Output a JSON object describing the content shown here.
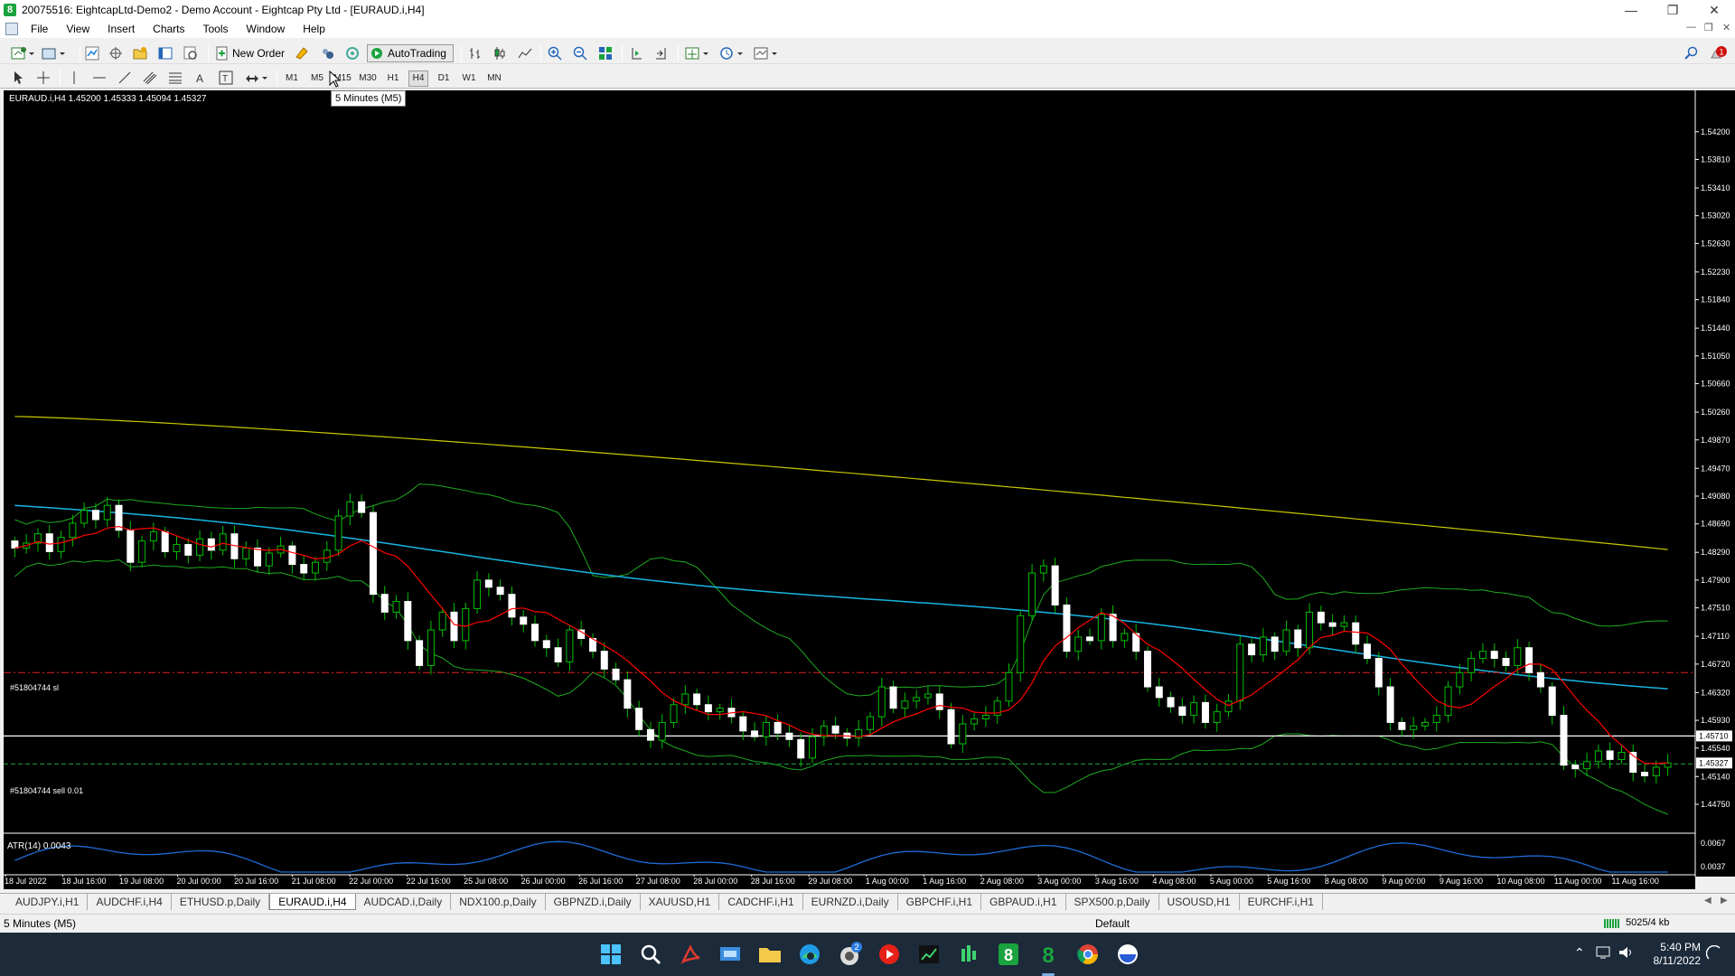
{
  "window": {
    "title": "20075516: EightcapLtd-Demo2 - Demo Account - Eightcap Pty Ltd - [EURAUD.i,H4]"
  },
  "menu": [
    "File",
    "View",
    "Insert",
    "Charts",
    "Tools",
    "Window",
    "Help"
  ],
  "toolbar": {
    "new_order": "New Order",
    "autotrading": "AutoTrading"
  },
  "timeframes": [
    "M1",
    "M5",
    "M15",
    "M30",
    "H1",
    "H4",
    "D1",
    "W1",
    "MN"
  ],
  "active_timeframe": "H4",
  "tooltip": "5 Minutes (M5)",
  "chart": {
    "info": "EURAUD.i,H4  1.45200 1.45333 1.45094 1.45327",
    "sl_label": "#51804744 sl",
    "order_label": "#51804744 sell 0.01",
    "atr_label": "ATR(14) 0.0043",
    "current_price_label": "1.45327",
    "hline_price_label": "1.45710",
    "atr_axis": [
      "0.0067",
      "0.0037"
    ]
  },
  "chart_data": {
    "type": "candlestick",
    "symbol": "EURAUD.i",
    "timeframe": "H4",
    "ylim": [
      1.4475,
      1.544
    ],
    "price_axis": [
      "1.54200",
      "1.53810",
      "1.53410",
      "1.53020",
      "1.52630",
      "1.52230",
      "1.51840",
      "1.51440",
      "1.51050",
      "1.50660",
      "1.50260",
      "1.49870",
      "1.49470",
      "1.49080",
      "1.48690",
      "1.48290",
      "1.47900",
      "1.47510",
      "1.47110",
      "1.46720",
      "1.46320",
      "1.45930",
      "1.45540",
      "1.45140",
      "1.44750"
    ],
    "time_axis": [
      "18 Jul 2022",
      "18 Jul 16:00",
      "19 Jul 08:00",
      "20 Jul 00:00",
      "20 Jul 16:00",
      "21 Jul 08:00",
      "22 Jul 00:00",
      "22 Jul 16:00",
      "25 Jul 08:00",
      "26 Jul 00:00",
      "26 Jul 16:00",
      "27 Jul 08:00",
      "28 Jul 00:00",
      "28 Jul 16:00",
      "29 Jul 08:00",
      "1 Aug 00:00",
      "1 Aug 16:00",
      "2 Aug 08:00",
      "3 Aug 00:00",
      "3 Aug 16:00",
      "4 Aug 08:00",
      "5 Aug 00:00",
      "5 Aug 16:00",
      "8 Aug 08:00",
      "9 Aug 00:00",
      "9 Aug 16:00",
      "10 Aug 08:00",
      "11 Aug 00:00",
      "11 Aug 16:00"
    ],
    "closes": [
      1.4835,
      1.4842,
      1.4855,
      1.483,
      1.485,
      1.487,
      1.4888,
      1.4875,
      1.4895,
      1.486,
      1.4815,
      1.4845,
      1.4858,
      1.483,
      1.484,
      1.4825,
      1.4848,
      1.4832,
      1.4855,
      1.482,
      1.4835,
      1.481,
      1.4828,
      1.4838,
      1.4812,
      1.48,
      1.4815,
      1.4832,
      1.488,
      1.49,
      1.4885,
      1.477,
      1.4745,
      1.476,
      1.4705,
      1.467,
      1.472,
      1.4745,
      1.4705,
      1.475,
      1.479,
      1.478,
      1.477,
      1.4738,
      1.4728,
      1.4705,
      1.4695,
      1.4675,
      1.472,
      1.4708,
      1.469,
      1.4665,
      1.465,
      1.461,
      1.458,
      1.4565,
      1.459,
      1.4615,
      1.463,
      1.4615,
      1.4605,
      1.461,
      1.4598,
      1.4578,
      1.457,
      1.459,
      1.4575,
      1.4566,
      1.454,
      1.457,
      1.4585,
      1.4575,
      1.4568,
      1.458,
      1.4598,
      1.464,
      1.461,
      1.462,
      1.4625,
      1.463,
      1.4608,
      1.456,
      1.4588,
      1.4595,
      1.46,
      1.462,
      1.466,
      1.474,
      1.48,
      1.481,
      1.4755,
      1.469,
      1.471,
      1.4705,
      1.4742,
      1.4705,
      1.4715,
      1.469,
      1.464,
      1.4625,
      1.4612,
      1.46,
      1.4618,
      1.459,
      1.4605,
      1.462,
      1.47,
      1.4685,
      1.471,
      1.469,
      1.472,
      1.4695,
      1.4745,
      1.473,
      1.4725,
      1.473,
      1.47,
      1.468,
      1.464,
      1.459,
      1.458,
      1.4585,
      1.459,
      1.46,
      1.464,
      1.466,
      1.468,
      1.469,
      1.468,
      1.467,
      1.4695,
      1.466,
      1.464,
      1.46,
      1.453,
      1.4525,
      1.4535,
      1.455,
      1.4538,
      1.4548,
      1.452,
      1.4515,
      1.4527,
      1.4533
    ],
    "ma_slow_start": 1.502,
    "ma_slow_end": 1.4833,
    "order_price": 1.4533,
    "sl_price": 1.466,
    "hline_price": 1.4571,
    "atr_range": [
      0.0037,
      0.0067
    ]
  },
  "tabs": [
    "AUDJPY.i,H1",
    "AUDCHF.i,H4",
    "ETHUSD.p,Daily",
    "EURAUD.i,H4",
    "AUDCAD.i,Daily",
    "NDX100.p,Daily",
    "GBPNZD.i,Daily",
    "XAUUSD,H1",
    "CADCHF.i,H1",
    "EURNZD.i,Daily",
    "GBPCHF.i,H1",
    "GBPAUD.i,H1",
    "SPX500.p,Daily",
    "USOUSD,H1",
    "EURCHF.i,H1"
  ],
  "active_tab": "EURAUD.i,H4",
  "status": {
    "left": "5 Minutes (M5)",
    "profile": "Default",
    "traffic": "5025/4 kb"
  },
  "clock": {
    "time": "5:40 PM",
    "date": "8/11/2022"
  },
  "colors": {
    "bullish": "#00c000",
    "bearish": "#ffffff",
    "ma_red": "#ff0000",
    "ma_cyan": "#19b4e0",
    "ma_yellow": "#c8c800",
    "band_green": "#1faa1f",
    "atr_blue": "#1e6bd6"
  },
  "taskbar_badge": "2",
  "notification_badge": "1"
}
